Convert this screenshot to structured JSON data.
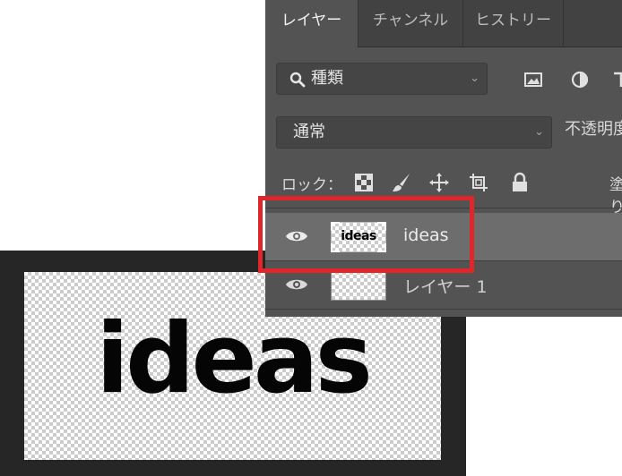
{
  "panel": {
    "tabs": [
      {
        "label": "レイヤー",
        "active": true
      },
      {
        "label": "チャンネル",
        "active": false
      },
      {
        "label": "ヒストリー",
        "active": false
      }
    ],
    "filter": {
      "icon": "search-icon",
      "label": "種類",
      "filter_icons": [
        "image-filter-icon",
        "adjustment-filter-icon",
        "text-filter-icon"
      ]
    },
    "blend_mode": "通常",
    "opacity_label": "不透明度",
    "lock": {
      "label": "ロック：",
      "icons": [
        "lock-transparent-pixels-icon",
        "lock-image-pixels-icon",
        "lock-position-icon",
        "lock-artboard-icon",
        "lock-all-icon"
      ]
    },
    "fill_label": "塗り",
    "layers": [
      {
        "name": "ideas",
        "thumbnail_text": "ideas",
        "type": "smart-object",
        "visible": true,
        "selected": true
      },
      {
        "name": "レイヤー 1",
        "type": "pixel",
        "visible": true,
        "selected": false
      }
    ]
  },
  "canvas": {
    "text": "ideas"
  },
  "colors": {
    "highlight": "#e0262b",
    "panel_bg": "#535353",
    "selected_row": "#6d6d6d"
  }
}
